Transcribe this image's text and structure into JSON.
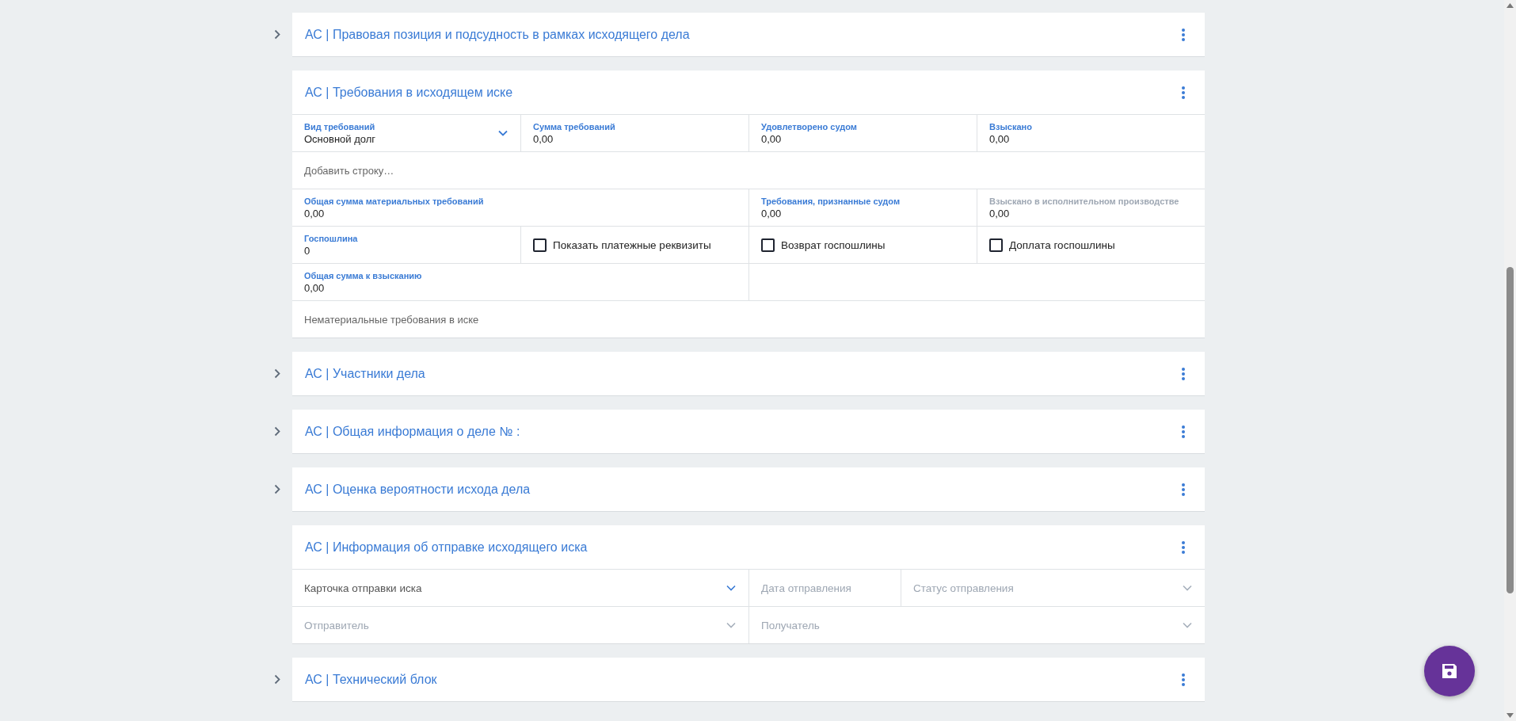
{
  "sections": [
    {
      "title": "АС | Правовая позиция и подсудность в рамках исходящего дела",
      "expanded": false
    },
    {
      "title": "АС | Требования в исходящем иске",
      "expanded": true,
      "rows": [
        [
          {
            "kind": "select",
            "label": "Вид требований",
            "value": "Основной долг",
            "disabled": false
          },
          {
            "kind": "field",
            "label": "Сумма требований",
            "value": "0,00",
            "disabled": false
          },
          {
            "kind": "field",
            "label": "Удовлетворено судом",
            "value": "0,00",
            "disabled": false
          },
          {
            "kind": "field",
            "label": "Взыскано",
            "value": "0,00",
            "disabled": false
          }
        ],
        [
          {
            "kind": "action",
            "text": "Добавить строку…"
          }
        ],
        [
          {
            "kind": "field",
            "label": "Общая сумма материальных требований",
            "value": "0,00",
            "disabled": false
          },
          "",
          {
            "kind": "field",
            "label": "Требования, признанные судом",
            "value": "0,00",
            "disabled": false
          },
          {
            "kind": "field",
            "label": "Взыскано в исполнительном производстве",
            "value": "0,00",
            "disabled": true
          }
        ],
        [
          {
            "kind": "field",
            "label": "Госпошлина",
            "value": "0",
            "disabled": false
          },
          {
            "kind": "checkbox",
            "label": "Показать платежные реквизиты",
            "checked": false
          },
          {
            "kind": "checkbox",
            "label": "Возврат госпошлины",
            "checked": false
          },
          {
            "kind": "checkbox",
            "label": "Доплата госпошлины",
            "checked": false
          }
        ],
        [
          {
            "kind": "field",
            "label": "Общая сумма к взысканию",
            "value": "0,00",
            "disabled": false
          }
        ],
        [
          {
            "kind": "note",
            "text": "Нематериальные требования в иске"
          }
        ]
      ]
    },
    {
      "title": "АС | Участники дела",
      "expanded": false
    },
    {
      "title": "АС | Общая информация о деле № :",
      "expanded": false
    },
    {
      "title": "АС | Оценка вероятности исхода дела",
      "expanded": false
    },
    {
      "title": "АС | Информация об отправке исходящего иска",
      "expanded": true,
      "rows": [
        [
          {
            "kind": "dropdown",
            "placeholder": "Карточка отправки иска",
            "disabled": false
          },
          {
            "kind": "input",
            "placeholder": "Дата отправления"
          },
          {
            "kind": "dropdown",
            "placeholder": "Статус отправления",
            "disabled": true
          }
        ],
        [
          {
            "kind": "dropdown",
            "placeholder": "Отправитель",
            "disabled": true
          },
          {
            "kind": "dropdown",
            "placeholder": "Получатель",
            "disabled": true
          }
        ]
      ]
    },
    {
      "title": "АС | Технический блок",
      "expanded": false
    }
  ]
}
